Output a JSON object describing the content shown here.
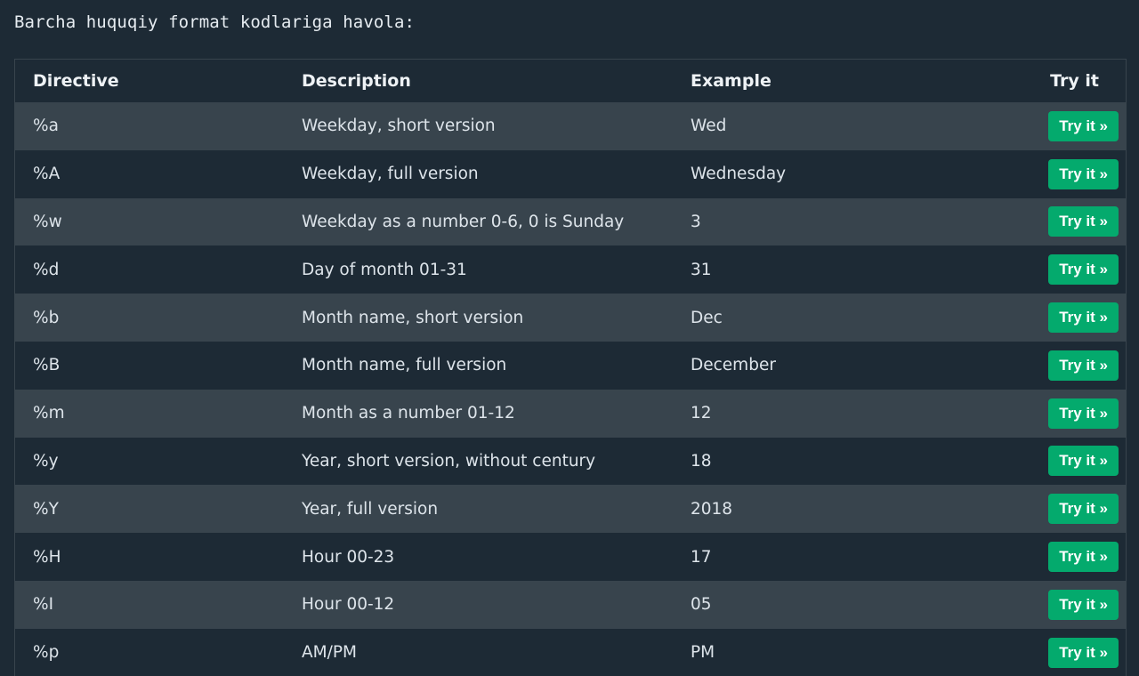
{
  "intro_text": "Barcha huquqiy format kodlariga havola:",
  "table": {
    "headers": [
      "Directive",
      "Description",
      "Example",
      "Try it"
    ],
    "button_label": "Try it »",
    "rows": [
      {
        "directive": "%a",
        "description": "Weekday, short version",
        "example": "Wed"
      },
      {
        "directive": "%A",
        "description": "Weekday, full version",
        "example": "Wednesday"
      },
      {
        "directive": "%w",
        "description": "Weekday as a number 0-6, 0 is Sunday",
        "example": "3"
      },
      {
        "directive": "%d",
        "description": "Day of month 01-31",
        "example": "31"
      },
      {
        "directive": "%b",
        "description": "Month name, short version",
        "example": "Dec"
      },
      {
        "directive": "%B",
        "description": "Month name, full version",
        "example": "December"
      },
      {
        "directive": "%m",
        "description": "Month as a number 01-12",
        "example": "12"
      },
      {
        "directive": "%y",
        "description": "Year, short version, without century",
        "example": "18"
      },
      {
        "directive": "%Y",
        "description": "Year, full version",
        "example": "2018"
      },
      {
        "directive": "%H",
        "description": "Hour 00-23",
        "example": "17"
      },
      {
        "directive": "%I",
        "description": "Hour 00-12",
        "example": "05"
      },
      {
        "directive": "%p",
        "description": "AM/PM",
        "example": "PM"
      }
    ]
  },
  "colors": {
    "background": "#1d2a35",
    "row_alt": "#38444d",
    "button": "#04aa6d"
  }
}
